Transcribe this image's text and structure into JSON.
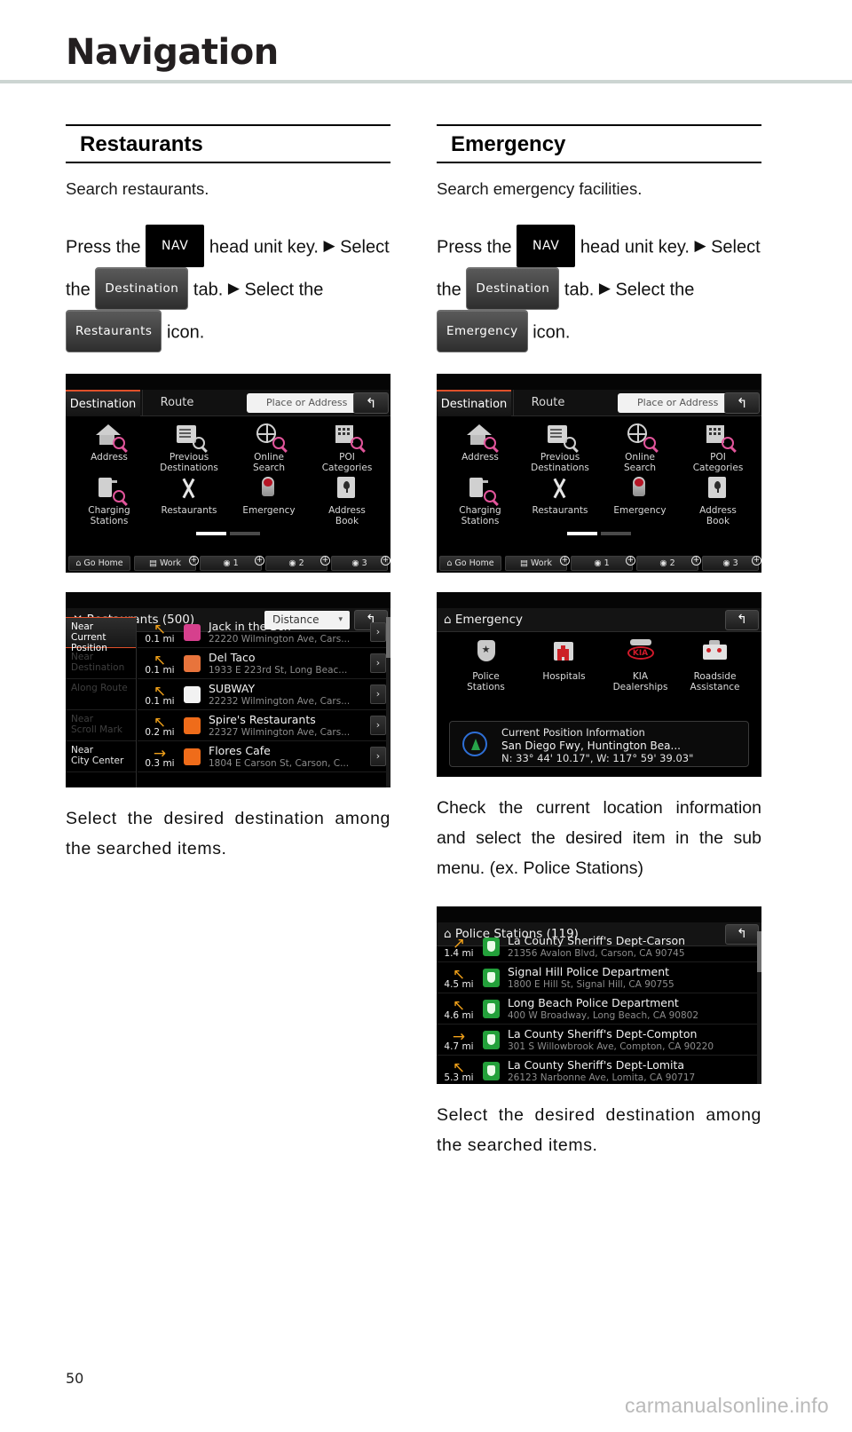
{
  "document": {
    "chapter_title": "Navigation",
    "page_number": "50",
    "watermark": "carmanualsonline.info"
  },
  "left_section": {
    "heading": "Restaurants",
    "intro": "Search restaurants.",
    "steps": {
      "press_the": "Press the",
      "nav_key": "NAV",
      "head_unit_key": "head unit key.",
      "select_the": "Select the",
      "destination_tab": "Destination",
      "tab_word": "tab.",
      "select_word": "Select",
      "the_word": "the",
      "feature_chip": "Restaurants",
      "icon_word": "icon."
    },
    "caption": "Select the desired destination among the searched items."
  },
  "right_section": {
    "heading": "Emergency",
    "intro": "Search emergency facilities.",
    "steps": {
      "press_the": "Press the",
      "nav_key": "NAV",
      "head_unit_key": "head unit key.",
      "select_the": "Select the",
      "destination_tab": "Destination",
      "tab_word": "tab.",
      "select_word": "Select",
      "the_word": "the",
      "feature_chip": "Emergency",
      "icon_word": "icon."
    },
    "caption_1": "Check the current location information and select the desired item in the sub menu. (ex. Police Stations)",
    "caption_2": "Select the desired destination among the searched items."
  },
  "destination_screen": {
    "tabs": [
      {
        "label": "Destination",
        "active": true
      },
      {
        "label": "Route",
        "active": false
      }
    ],
    "search_placeholder": "Place or Address",
    "back_icon": "back-arrow-icon",
    "icons": [
      {
        "label": "Address",
        "icon": "house-search-icon"
      },
      {
        "label": "Previous\nDestinations",
        "label_line1": "Previous",
        "label_line2": "Destinations",
        "icon": "document-search-icon"
      },
      {
        "label_line1": "Online",
        "label_line2": "Search",
        "icon": "globe-search-icon"
      },
      {
        "label_line1": "POI",
        "label_line2": "Categories",
        "icon": "building-search-icon"
      },
      {
        "label_line1": "Charging",
        "label_line2": "Stations",
        "icon": "charging-station-search-icon"
      },
      {
        "label_line1": "Restaurants",
        "label_line2": "",
        "icon": "fork-knife-icon"
      },
      {
        "label_line1": "Emergency",
        "label_line2": "",
        "icon": "emergency-beacon-icon"
      },
      {
        "label_line1": "Address",
        "label_line2": "Book",
        "icon": "address-book-icon"
      }
    ],
    "favorites": [
      {
        "label": "Go Home",
        "icon": "home-icon",
        "plus": false
      },
      {
        "label": "Work",
        "icon": "briefcase-icon",
        "plus": true
      },
      {
        "label": "1",
        "icon": "pin-icon",
        "plus": true
      },
      {
        "label": "2",
        "icon": "pin-icon",
        "plus": true
      },
      {
        "label": "3",
        "icon": "pin-icon",
        "plus": true
      }
    ],
    "pager": {
      "current": 1,
      "total": 2
    }
  },
  "restaurants_screen": {
    "title": "Restaurants (500)",
    "title_icon": "fork-knife-icon",
    "sort_value": "Distance",
    "back_icon": "back-arrow-icon",
    "side_filters": [
      {
        "label_line1": "Near Current",
        "label_line2": "Position",
        "active": true
      },
      {
        "label_line1": "Near",
        "label_line2": "Destination",
        "active": false
      },
      {
        "label_line1": "Along Route",
        "label_line2": "",
        "active": false
      },
      {
        "label_line1": "Near",
        "label_line2": "Scroll Mark",
        "active": false
      },
      {
        "label_line1": "Near",
        "label_line2": "City Center",
        "active": false
      }
    ],
    "rows": [
      {
        "distance": "0.1 mi",
        "arrow": "up-left",
        "name": "Jack in the Box",
        "address": "22220 Wilmington Ave, Cars...",
        "brand_color": "#d6408d"
      },
      {
        "distance": "0.1 mi",
        "arrow": "up-left",
        "name": "Del Taco",
        "address": "1933 E 223rd St, Long Beac...",
        "brand_color": "#e8743c"
      },
      {
        "distance": "0.1 mi",
        "arrow": "up-left",
        "name": "SUBWAY",
        "address": "22232 Wilmington Ave, Cars...",
        "brand_color": "#f2f2f2"
      },
      {
        "distance": "0.2 mi",
        "arrow": "up-left",
        "name": "Spire's Restaurants",
        "address": "22327 Wilmington Ave, Cars...",
        "brand_color": "#ef6c1a"
      },
      {
        "distance": "0.3 mi",
        "arrow": "right",
        "name": "Flores Cafe",
        "address": "1804 E Carson St, Carson, C...",
        "brand_color": "#ef6c1a"
      }
    ]
  },
  "emergency_screen": {
    "title": "Emergency",
    "title_icon": "emergency-beacon-icon",
    "back_icon": "back-arrow-icon",
    "icons": [
      {
        "label_line1": "Police",
        "label_line2": "Stations",
        "icon": "police-badge-icon"
      },
      {
        "label_line1": "Hospitals",
        "label_line2": "",
        "icon": "hospital-icon"
      },
      {
        "label_line1": "KIA",
        "label_line2": "Dealerships",
        "icon": "kia-logo-icon",
        "logo_text": "KIA"
      },
      {
        "label_line1": "Roadside",
        "label_line2": "Assistance",
        "icon": "toolbox-icon"
      }
    ],
    "position_panel": {
      "title": "Current Position Information",
      "address": "San Diego Fwy, Huntington Bea...",
      "coordinates": "N: 33° 44' 10.17\", W: 117° 59' 39.03\"",
      "compass_icon": "compass-icon"
    }
  },
  "police_screen": {
    "title": "Police Stations (119)",
    "title_icon": "emergency-beacon-icon",
    "back_icon": "back-arrow-icon",
    "rows": [
      {
        "distance": "1.4 mi",
        "arrow": "up-right",
        "name": "La County Sheriff's Dept-Carson",
        "address": "21356 Avalon Blvd, Carson, CA 90745"
      },
      {
        "distance": "4.5 mi",
        "arrow": "up-left",
        "name": "Signal Hill Police Department",
        "address": "1800 E Hill St, Signal Hill, CA 90755"
      },
      {
        "distance": "4.6 mi",
        "arrow": "up-left",
        "name": "Long Beach Police Department",
        "address": "400 W Broadway, Long Beach, CA 90802"
      },
      {
        "distance": "4.7 mi",
        "arrow": "right",
        "name": "La County Sheriff's Dept-Compton",
        "address": "301 S Willowbrook Ave, Compton, CA 90220"
      },
      {
        "distance": "5.3 mi",
        "arrow": "up-left",
        "name": "La County Sheriff's Dept-Lomita",
        "address": "26123 Narbonne Ave, Lomita, CA 90717"
      }
    ]
  },
  "colors": {
    "accent_orange": "#e0502a",
    "arrow_orange": "#f0a019",
    "magnifier_pink": "#e2559b",
    "police_green": "#23a03a",
    "kia_red": "#d11a2a",
    "header_rule": "#ccd5d2"
  }
}
